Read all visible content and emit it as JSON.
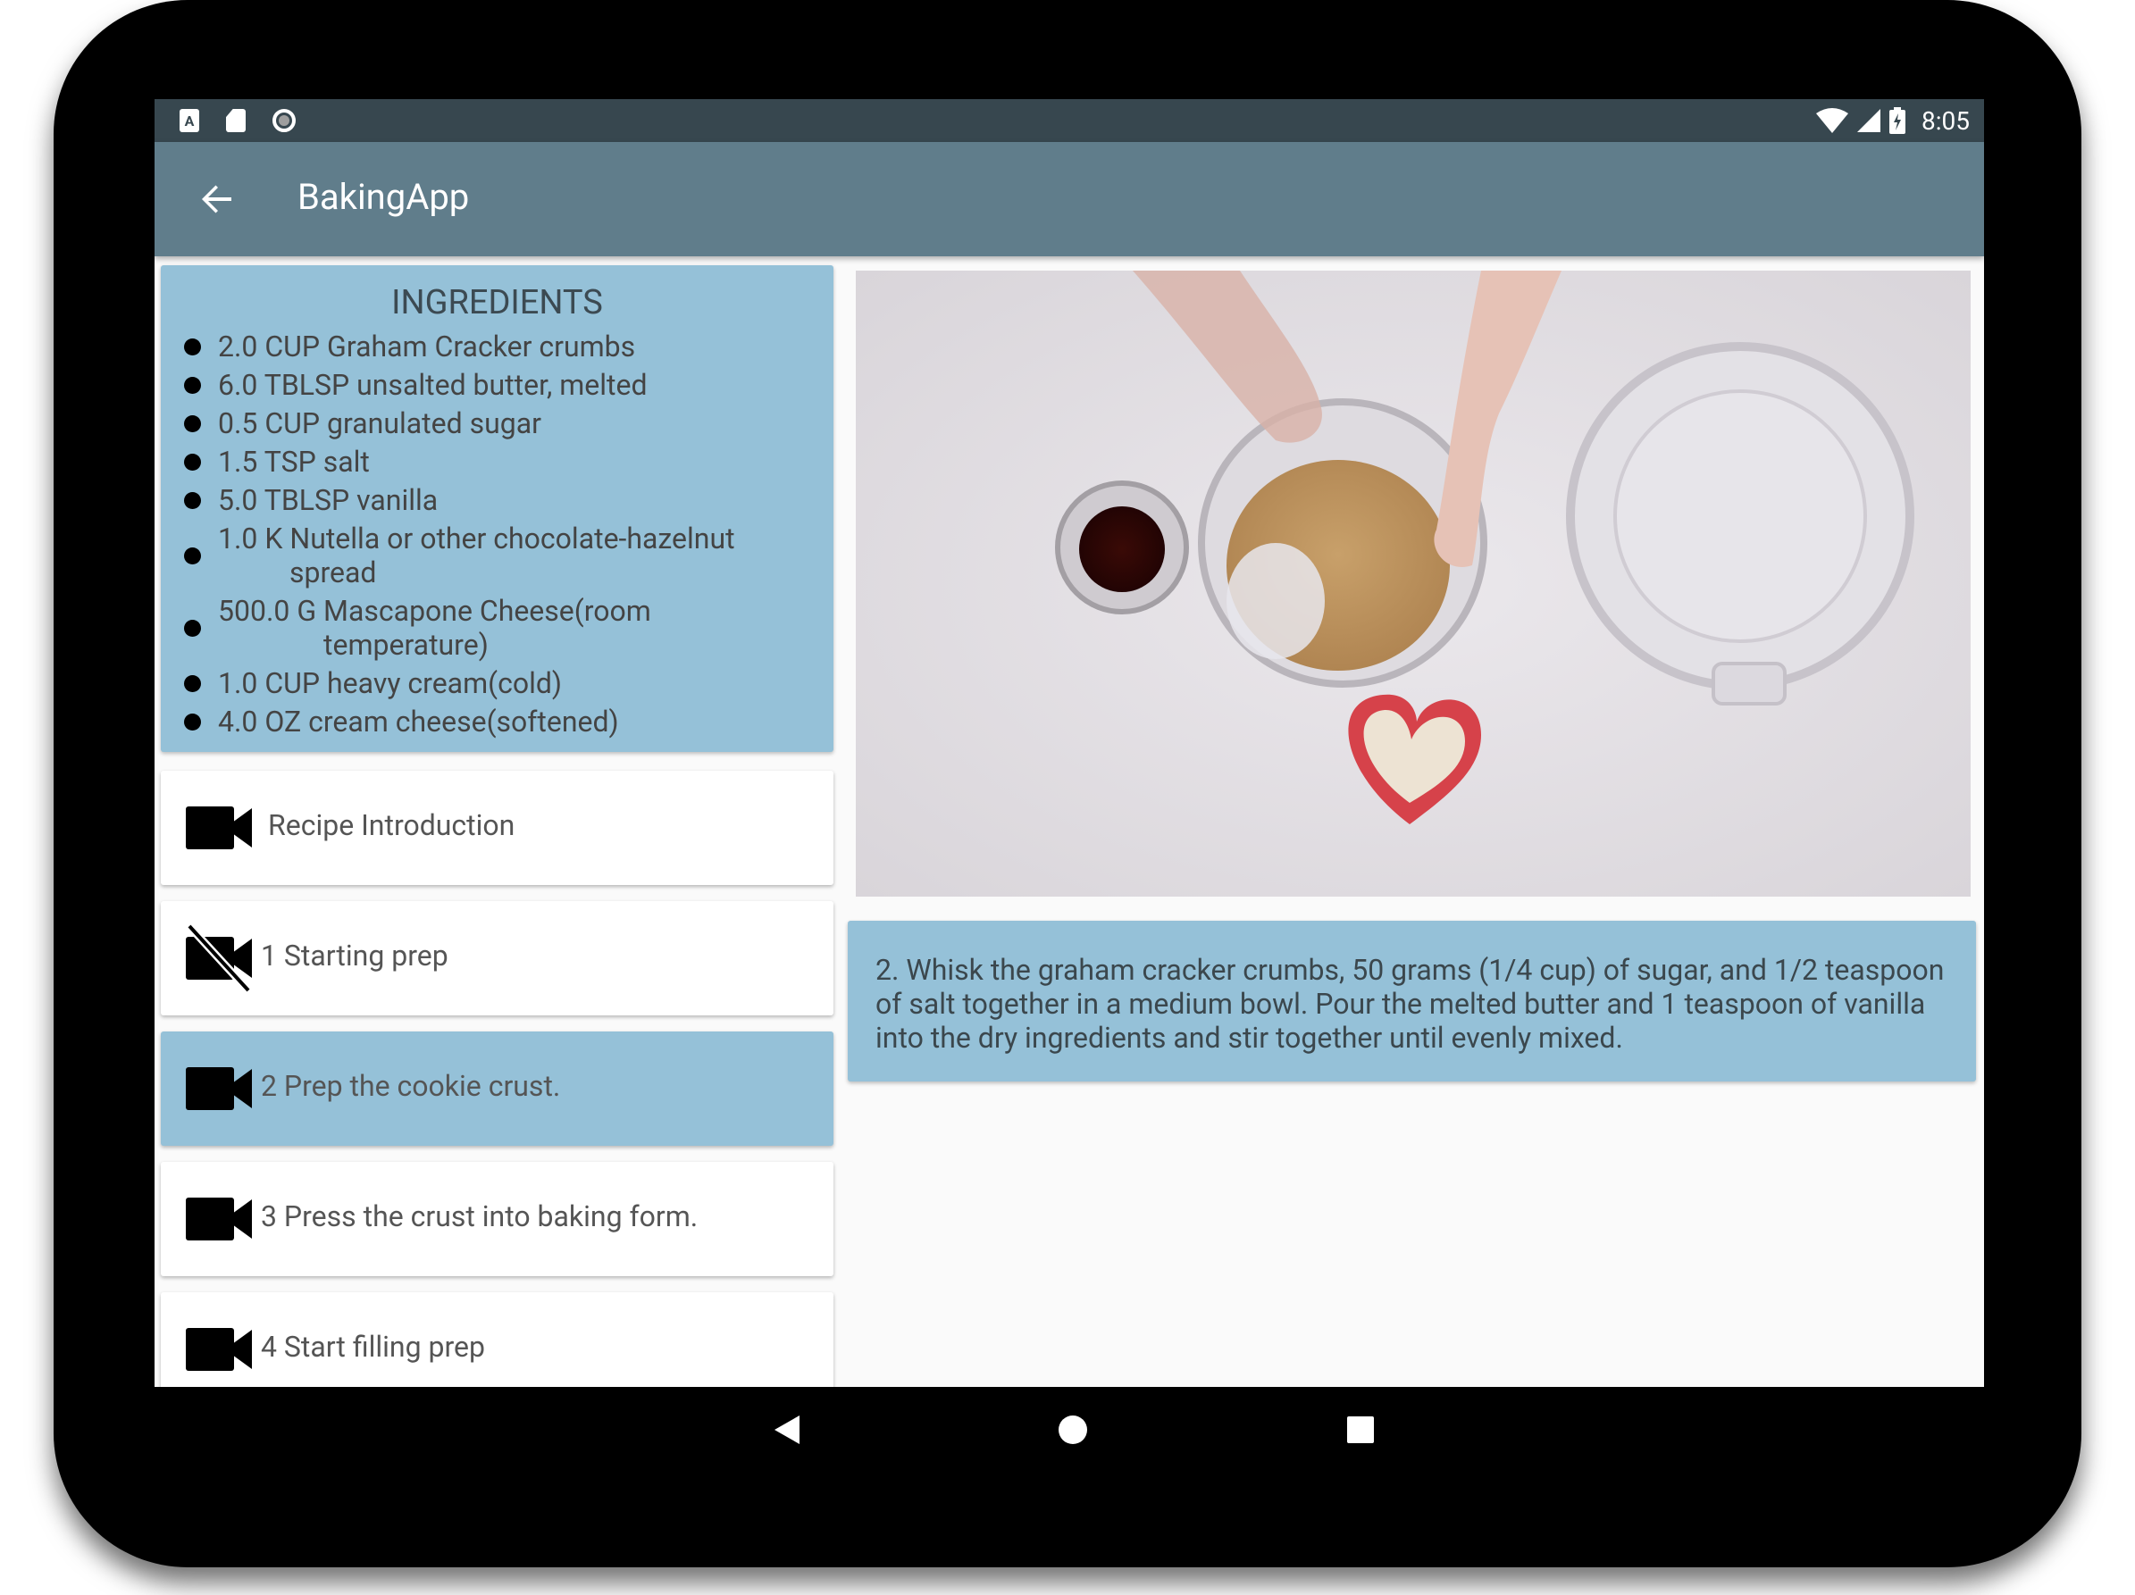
{
  "status_bar": {
    "time": "8:05",
    "left_icons": [
      "a-icon",
      "sd-card-icon",
      "record-icon"
    ],
    "right_icons": [
      "wifi-icon",
      "signal-icon",
      "battery-charging-icon"
    ]
  },
  "toolbar": {
    "title": "BakingApp",
    "back_icon": "arrow-back-icon"
  },
  "ingredients": {
    "title": "INGREDIENTS",
    "items": [
      {
        "line1": "2.0 CUP Graham Cracker crumbs",
        "line2": ""
      },
      {
        "line1": "6.0 TBLSP unsalted butter, melted",
        "line2": ""
      },
      {
        "line1": "0.5 CUP granulated sugar",
        "line2": ""
      },
      {
        "line1": "1.5 TSP salt",
        "line2": ""
      },
      {
        "line1": "5.0 TBLSP vanilla",
        "line2": ""
      },
      {
        "line1": "1.0 K Nutella or other chocolate-hazelnut",
        "line2": "spread"
      },
      {
        "line1": "500.0 G Mascapone Cheese(room",
        "line2": "temperature)"
      },
      {
        "line1": "1.0 CUP heavy cream(cold)",
        "line2": ""
      },
      {
        "line1": "4.0 OZ cream cheese(softened)",
        "line2": ""
      }
    ]
  },
  "steps": [
    {
      "label": "Recipe Introduction",
      "icon": "videocam-icon",
      "selected": false
    },
    {
      "label": "1 Starting prep",
      "icon": "videocam-off-icon",
      "selected": false
    },
    {
      "label": "2 Prep the cookie crust.",
      "icon": "videocam-icon",
      "selected": true
    },
    {
      "label": "3 Press the crust into baking form.",
      "icon": "videocam-icon",
      "selected": false
    },
    {
      "label": "4 Start filling prep",
      "icon": "videocam-icon",
      "selected": false
    }
  ],
  "step_description": "2. Whisk the graham cracker crumbs, 50 grams (1/4 cup) of sugar, and 1/2 teaspoon of salt together in a medium bowl. Pour the melted butter and 1 teaspoon of vanilla into the dry ingredients and stir together until evenly mixed.",
  "nav_bar": {
    "icons": [
      "nav-back-icon",
      "nav-home-icon",
      "nav-recents-icon"
    ]
  },
  "colors": {
    "toolbar": "#607d8b",
    "status_bar": "#37474f",
    "card_highlight": "#95c1d8",
    "card_default": "#ffffff"
  }
}
